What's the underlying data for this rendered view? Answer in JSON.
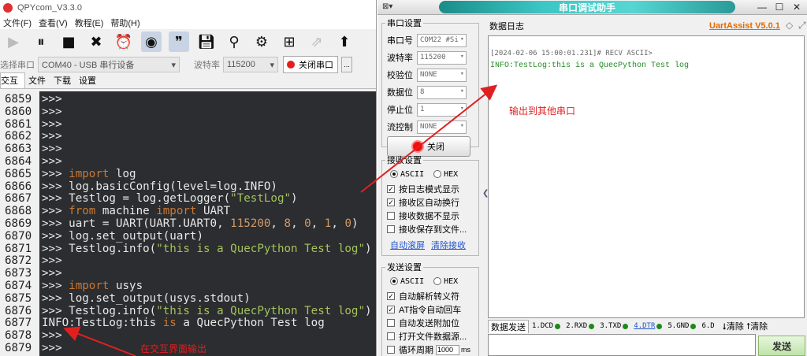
{
  "qpy": {
    "title": "QPYcom_V3.3.0",
    "menu": [
      "文件(F)",
      "查看(V)",
      "教程(E)",
      "帮助(H)"
    ],
    "toolbar_icons": [
      "run-icon",
      "pause-icon",
      "stop-icon",
      "close-icon",
      "alarm-clock-icon",
      "headset-icon",
      "quote-icon",
      "save-icon",
      "search-icon",
      "gear-icon",
      "plus-box-icon",
      "export-icon",
      "upload-icon"
    ],
    "port_label": "选择串口",
    "port_value": "COM40 - USB 串行设备",
    "baud_label": "波特率",
    "baud_value": "115200",
    "close_port_label": "关闭串口",
    "more_label": "...",
    "tabs": [
      "交互",
      "文件",
      "下载",
      "设置"
    ],
    "console_lines": [
      {
        "n": "6859",
        "parts": [
          [
            ">>>",
            ""
          ]
        ]
      },
      {
        "n": "6860",
        "parts": [
          [
            ">>>",
            ""
          ]
        ]
      },
      {
        "n": "6861",
        "parts": [
          [
            ">>>",
            ""
          ]
        ]
      },
      {
        "n": "6862",
        "parts": [
          [
            ">>>",
            ""
          ]
        ]
      },
      {
        "n": "6863",
        "parts": [
          [
            ">>>",
            ""
          ]
        ]
      },
      {
        "n": "6864",
        "parts": [
          [
            ">>>",
            ""
          ]
        ]
      },
      {
        "n": "6865",
        "parts": [
          [
            ">>> ",
            ""
          ],
          [
            "import",
            "kw"
          ],
          [
            " log",
            ""
          ]
        ]
      },
      {
        "n": "6866",
        "parts": [
          [
            ">>> log.basicConfig(level=log.INFO)",
            ""
          ]
        ]
      },
      {
        "n": "6867",
        "parts": [
          [
            ">>> Testlog = log.getLogger(",
            ""
          ],
          [
            "\"TestLog\"",
            "str"
          ],
          [
            ")",
            ""
          ]
        ]
      },
      {
        "n": "6868",
        "parts": [
          [
            ">>> ",
            ""
          ],
          [
            "from",
            "kw"
          ],
          [
            " machine ",
            ""
          ],
          [
            "import",
            "kw"
          ],
          [
            " UART",
            ""
          ]
        ]
      },
      {
        "n": "6869",
        "parts": [
          [
            ">>> uart = UART(UART.UART0, ",
            ""
          ],
          [
            "115200",
            "num"
          ],
          [
            ", ",
            ""
          ],
          [
            "8",
            "num"
          ],
          [
            ", ",
            ""
          ],
          [
            "0",
            "num"
          ],
          [
            ", ",
            ""
          ],
          [
            "1",
            "num"
          ],
          [
            ", ",
            ""
          ],
          [
            "0",
            "num"
          ],
          [
            ")",
            ""
          ]
        ]
      },
      {
        "n": "6870",
        "parts": [
          [
            ">>> log.set_output(uart)",
            ""
          ]
        ]
      },
      {
        "n": "6871",
        "parts": [
          [
            ">>> Testlog.info(",
            ""
          ],
          [
            "\"this is a QuecPython Test log\"",
            "str"
          ],
          [
            ")",
            ""
          ]
        ]
      },
      {
        "n": "6872",
        "parts": [
          [
            ">>>",
            ""
          ]
        ]
      },
      {
        "n": "6873",
        "parts": [
          [
            ">>>",
            ""
          ]
        ]
      },
      {
        "n": "6874",
        "parts": [
          [
            ">>> ",
            ""
          ],
          [
            "import",
            "kw"
          ],
          [
            " usys",
            ""
          ]
        ]
      },
      {
        "n": "6875",
        "parts": [
          [
            ">>> log.set_output(usys.stdout)",
            ""
          ]
        ]
      },
      {
        "n": "6876",
        "parts": [
          [
            ">>> Testlog.info(",
            ""
          ],
          [
            "\"this is a QuecPython Test log\"",
            "str"
          ],
          [
            ")",
            ""
          ]
        ]
      },
      {
        "n": "6877",
        "parts": [
          [
            "INFO:TestLog:this ",
            ""
          ],
          [
            "is",
            "kw"
          ],
          [
            " a QuecPython Test log",
            ""
          ]
        ]
      },
      {
        "n": "6878",
        "parts": [
          [
            ">>>",
            ""
          ]
        ]
      },
      {
        "n": "6879",
        "parts": [
          [
            ">>>",
            ""
          ]
        ]
      }
    ]
  },
  "uart": {
    "title": "串口调试助手",
    "serial_group": "串口设置",
    "fields": [
      {
        "label": "串口号",
        "value": "COM22 #Si"
      },
      {
        "label": "波特率",
        "value": "115200"
      },
      {
        "label": "校验位",
        "value": "NONE"
      },
      {
        "label": "数据位",
        "value": "8"
      },
      {
        "label": "停止位",
        "value": "1"
      },
      {
        "label": "流控制",
        "value": "NONE"
      }
    ],
    "close_label": "关闭",
    "recv_group": "接收设置",
    "recv_ascii": "ASCII",
    "recv_hex": "HEX",
    "recv_checks": [
      {
        "label": "按日志模式显示",
        "checked": true
      },
      {
        "label": "接收区自动换行",
        "checked": true
      },
      {
        "label": "接收数据不显示",
        "checked": false
      },
      {
        "label": "接收保存到文件...",
        "checked": false
      }
    ],
    "auto_scroll": "自动滚屏",
    "clear_recv": "清除接收",
    "send_group": "发送设置",
    "send_ascii": "ASCII",
    "send_hex": "HEX",
    "send_checks": [
      {
        "label": "自动解析转义符",
        "checked": true
      },
      {
        "label": "AT指令自动回车",
        "checked": true
      },
      {
        "label": "自动发送附加位",
        "checked": false
      },
      {
        "label": "打开文件数据源...",
        "checked": false
      },
      {
        "label": "循环周期",
        "checked": false
      }
    ],
    "period_value": "1000",
    "period_unit": "ms",
    "log_tab": "数据日志",
    "brand": "UartAssist V5.0.1",
    "log_timestamp": "[2024-02-06 15:00:01.231]# RECV ASCII>",
    "log_message": "INFO:TestLog:this is a QuecPython Test log",
    "send_tab": "数据发送",
    "pins": [
      {
        "label": "1.DCD",
        "led": "#1b8a1b"
      },
      {
        "label": "2.RXD",
        "led": "#1b8a1b"
      },
      {
        "label": "3.TXD",
        "led": "#1b8a1b"
      },
      {
        "label": "4.DTR",
        "led": "#1b8a1b"
      },
      {
        "label": "5.GND",
        "led": "#1b8a1b"
      },
      {
        "label": "6.D",
        "led": ""
      }
    ],
    "clear1": "清除",
    "clear2": "清除",
    "send_button": "发送"
  },
  "annotations": {
    "to_other_port": "输出到其他串口",
    "to_interactive": "在交互界面输出"
  },
  "colors": {
    "console_bg": "#2b2d30",
    "keyword": "#cc7832",
    "string": "#a5c25c",
    "number": "#d19a66",
    "annotation": "#e02020",
    "log_green": "#228b22"
  }
}
